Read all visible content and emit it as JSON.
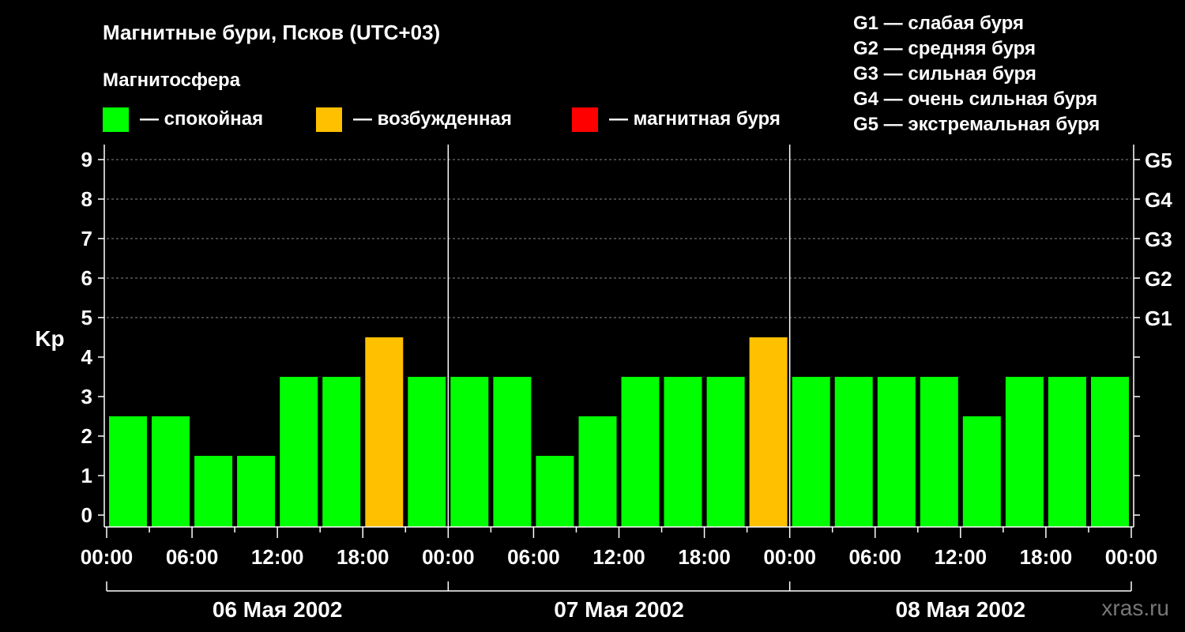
{
  "title": "Магнитные бури, Псков (UTC+03)",
  "subtitle": "Магнитосфера",
  "legend": [
    {
      "label": "— спокойная",
      "color": "#00ff00"
    },
    {
      "label": "— возбужденная",
      "color": "#ffc000"
    },
    {
      "label": "— магнитная буря",
      "color": "#ff0000"
    }
  ],
  "storm_scale": [
    "G1 — слабая буря",
    "G2 — средняя буря",
    "G3 — сильная буря",
    "G4 — очень сильная буря",
    "G5 — экстремальная буря"
  ],
  "watermark": "xras.ru",
  "colors": {
    "background": "#000000",
    "calm": "#00ff00",
    "excited": "#ffc000",
    "storm": "#ff0000",
    "axis": "#ffffff",
    "grid": "#888888"
  },
  "chart_data": {
    "type": "bar",
    "ylabel": "Kp",
    "ylim": [
      0,
      9
    ],
    "yticks": [
      "0",
      "1",
      "2",
      "3",
      "4",
      "5",
      "6",
      "7",
      "8",
      "9"
    ],
    "right_ticks": [
      {
        "kp": 5,
        "label": "G1"
      },
      {
        "kp": 6,
        "label": "G2"
      },
      {
        "kp": 7,
        "label": "G3"
      },
      {
        "kp": 8,
        "label": "G4"
      },
      {
        "kp": 9,
        "label": "G5"
      }
    ],
    "grid": "horizontal dashed at Kp 5–9",
    "xticks": [
      "00:00",
      "06:00",
      "12:00",
      "18:00",
      "00:00",
      "06:00",
      "12:00",
      "18:00",
      "00:00",
      "06:00",
      "12:00",
      "18:00",
      "00:00"
    ],
    "days": [
      "06 Мая 2002",
      "07 Мая 2002",
      "08 Мая 2002"
    ],
    "values": [
      2,
      2,
      1,
      1,
      3,
      3,
      4,
      3,
      3,
      3,
      1,
      2,
      3,
      3,
      3,
      4,
      3,
      3,
      3,
      3,
      2,
      3,
      3,
      3
    ],
    "level_colors": {
      "calm_max": 3,
      "excited": 4,
      "storm_min": 5
    }
  }
}
